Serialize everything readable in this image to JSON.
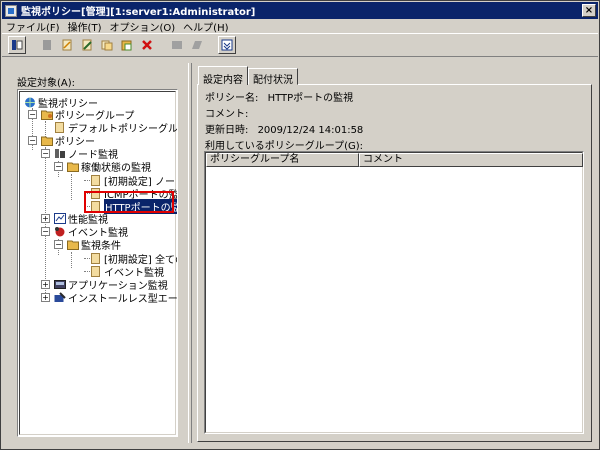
{
  "window": {
    "title": "監視ポリシー[管理][1:server1:Administrator]",
    "close_label": "×"
  },
  "menu": [
    "ファイル(F)",
    "操作(T)",
    "オプション(O)",
    "ヘルプ(H)"
  ],
  "toolbar": {
    "icons": [
      "policy-view-icon",
      "blank-page-icon",
      "new-icon",
      "edit-icon",
      "copy-icon",
      "paste-icon",
      "delete-icon",
      "disabled-icon-1",
      "disabled-icon-2",
      "collapse-icon"
    ],
    "colors": {
      "delete": "#d01010",
      "folder": "#e8b84a",
      "accent": "#0a246a"
    }
  },
  "left": {
    "label": "設定対象(A):",
    "tree": [
      {
        "label": "監視ポリシー",
        "icon": "globe-icon",
        "level": 0,
        "expander": ""
      },
      {
        "label": "ポリシーグループ",
        "icon": "group-folder-icon",
        "level": 1,
        "expander": "−"
      },
      {
        "label": "デフォルトポリシーグルー",
        "icon": "policy-doc-icon",
        "level": 2,
        "expander": ""
      },
      {
        "label": "ポリシー",
        "icon": "folder-icon",
        "level": 1,
        "expander": "−"
      },
      {
        "label": "ノード監視",
        "icon": "node-icon",
        "level": 2,
        "expander": "−"
      },
      {
        "label": "稼働状態の監視",
        "icon": "folder-icon",
        "level": 3,
        "expander": "−"
      },
      {
        "label": "[初期設定] ノード(",
        "icon": "policy-doc-icon",
        "level": 4,
        "expander": ""
      },
      {
        "label": "ICMPポートの監視",
        "icon": "policy-doc-icon",
        "level": 4,
        "expander": ""
      },
      {
        "label": "HTTPポートの監視",
        "icon": "policy-doc-icon",
        "level": 4,
        "expander": "",
        "selected": true
      },
      {
        "label": "性能監視",
        "icon": "chart-icon",
        "level": 2,
        "expander": "+"
      },
      {
        "label": "イベント監視",
        "icon": "event-icon",
        "level": 2,
        "expander": "−"
      },
      {
        "label": "監視条件",
        "icon": "folder-icon",
        "level": 3,
        "expander": "−"
      },
      {
        "label": "[初期設定] 全ての-",
        "icon": "policy-doc-icon",
        "level": 4,
        "expander": ""
      },
      {
        "label": "イベント監視",
        "icon": "policy-doc-icon",
        "level": 4,
        "expander": ""
      },
      {
        "label": "アプリケーション監視",
        "icon": "app-icon",
        "level": 2,
        "expander": "+"
      },
      {
        "label": "インストールレス型エージ",
        "icon": "agent-icon",
        "level": 2,
        "expander": "+"
      }
    ]
  },
  "right": {
    "tabs": [
      "設定内容",
      "配付状況"
    ],
    "policy_name_label": "ポリシー名:",
    "policy_name_value": "HTTPポートの監視",
    "comment_label": "コメント:",
    "comment_value": "",
    "updated_label": "更新日時:",
    "updated_value": "2009/12/24 14:01:58",
    "groups_label": "利用しているポリシーグループ(G):",
    "columns": [
      "ポリシーグループ名",
      "コメント"
    ]
  }
}
